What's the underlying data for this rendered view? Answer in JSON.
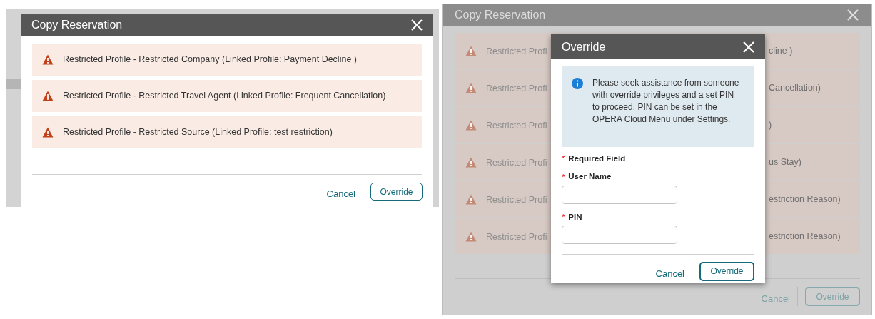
{
  "left_screenshot": {
    "dialog": {
      "title": "Copy Reservation",
      "messages": [
        {
          "text": "Restricted Profile - Restricted Company (Linked Profile: Payment Decline )"
        },
        {
          "text": "Restricted Profile - Restricted Travel Agent (Linked Profile: Frequent Cancellation)"
        },
        {
          "text": "Restricted Profile - Restricted Source (Linked Profile: test restriction)"
        }
      ],
      "buttons": [
        {
          "label": "Cancel",
          "kind": "link"
        },
        {
          "label": "Override",
          "kind": "outline"
        }
      ]
    }
  },
  "right_screenshot": {
    "dialog": {
      "title": "Copy Reservation",
      "messages": [
        {
          "left": "Restricted Profi",
          "right": "cline )"
        },
        {
          "left": "Restricted Profi",
          "right": "Cancellation)"
        },
        {
          "left": "Restricted Profi",
          "right": ")"
        },
        {
          "left": "Restricted Profi",
          "right": "us Stay)"
        },
        {
          "left": "Restricted Profi",
          "right": "estriction Reason)"
        },
        {
          "left": "Restricted Profi",
          "right": "estriction Reason)"
        }
      ],
      "buttons": [
        {
          "label": "Cancel",
          "kind": "link"
        },
        {
          "label": "Override",
          "kind": "outline"
        }
      ]
    },
    "override_dialog": {
      "title": "Override",
      "info": "Please seek assistance from someone with override privileges and a set PIN to proceed. PIN can be set in the OPERA Cloud Menu under Settings.",
      "required_note": {
        "mark": "*",
        "label": "Required Field"
      },
      "fields": [
        {
          "mark": "*",
          "label": "User Name"
        },
        {
          "mark": "*",
          "label": "PIN"
        }
      ],
      "buttons": [
        {
          "label": "Cancel",
          "kind": "link"
        },
        {
          "label": "Override",
          "kind": "outline"
        }
      ]
    }
  }
}
